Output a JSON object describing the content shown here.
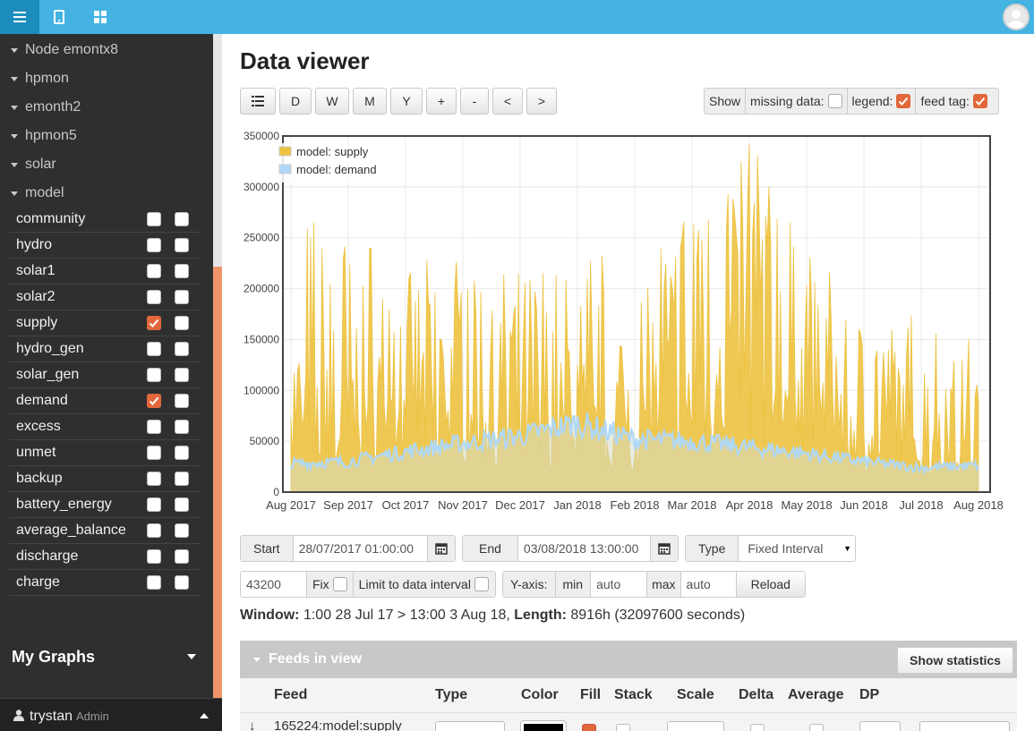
{
  "topbar": {
    "icons": [
      "menu-icon",
      "tablet-icon",
      "dashboard-icon"
    ],
    "avatar": "user-avatar-icon"
  },
  "sidebar": {
    "nodes": [
      {
        "label": "Node emontx8"
      },
      {
        "label": "hpmon"
      },
      {
        "label": "emonth2"
      },
      {
        "label": "hpmon5"
      },
      {
        "label": "solar"
      },
      {
        "label": "model"
      }
    ],
    "feeds": [
      {
        "name": "community",
        "left": false,
        "right": false
      },
      {
        "name": "hydro",
        "left": false,
        "right": false
      },
      {
        "name": "solar1",
        "left": false,
        "right": false
      },
      {
        "name": "solar2",
        "left": false,
        "right": false
      },
      {
        "name": "supply",
        "left": true,
        "right": false
      },
      {
        "name": "hydro_gen",
        "left": false,
        "right": false
      },
      {
        "name": "solar_gen",
        "left": false,
        "right": false
      },
      {
        "name": "demand",
        "left": true,
        "right": false
      },
      {
        "name": "excess",
        "left": false,
        "right": false
      },
      {
        "name": "unmet",
        "left": false,
        "right": false
      },
      {
        "name": "backup",
        "left": false,
        "right": false
      },
      {
        "name": "battery_energy",
        "left": false,
        "right": false
      },
      {
        "name": "average_balance",
        "left": false,
        "right": false
      },
      {
        "name": "discharge",
        "left": false,
        "right": false
      },
      {
        "name": "charge",
        "left": false,
        "right": false
      }
    ],
    "my_graphs": "My Graphs",
    "user": {
      "name": "trystan",
      "role": "Admin"
    }
  },
  "main": {
    "title": "Data viewer",
    "toolbar": {
      "list_icon": "list-icon",
      "buttons": [
        "D",
        "W",
        "M",
        "Y",
        "+",
        "-",
        "<",
        ">"
      ]
    },
    "show": {
      "label": "Show",
      "missing_data": {
        "label": "missing data:",
        "checked": false
      },
      "legend": {
        "label": "legend:",
        "checked": true
      },
      "feed_tag": {
        "label": "feed tag:",
        "checked": true
      }
    },
    "controls": {
      "start_label": "Start",
      "start_value": "28/07/2017 01:00:00",
      "end_label": "End",
      "end_value": "03/08/2018 13:00:00",
      "type_label": "Type",
      "type_value": "Fixed Interval",
      "interval_value": "43200",
      "fix_label": "Fix",
      "limit_label": "Limit to data interval",
      "yaxis_label": "Y-axis:",
      "min_label": "min",
      "min_value": "auto",
      "max_label": "max",
      "max_value": "auto",
      "reload_label": "Reload"
    },
    "window_info": {
      "window_label": "Window:",
      "window_value": "1:00 28 Jul 17 > 13:00 3 Aug 18,",
      "length_label": "Length:",
      "length_value": "8916h (32097600 seconds)"
    },
    "feeds_in_view": {
      "title": "Feeds in view",
      "stats_button": "Show statistics",
      "columns": [
        "Feed",
        "Type",
        "Color",
        "Fill",
        "Stack",
        "Scale",
        "Delta",
        "Average",
        "DP"
      ],
      "first_row_feed": "165224:model:supply"
    }
  },
  "chart_data": {
    "type": "area",
    "title": "",
    "xlabel": "",
    "ylabel": "",
    "ylim": [
      0,
      350000
    ],
    "yticks": [
      0,
      50000,
      100000,
      150000,
      200000,
      250000,
      300000,
      350000
    ],
    "x_tick_labels": [
      "Aug 2017",
      "Sep 2017",
      "Oct 2017",
      "Nov 2017",
      "Dec 2017",
      "Jan 2018",
      "Feb 2018",
      "Mar 2018",
      "Apr 2018",
      "May 2018",
      "Jun 2018",
      "Jul 2018",
      "Aug 2018"
    ],
    "legend_position": "top-left",
    "grid": true,
    "series": [
      {
        "name": "model: supply",
        "color": "#edc240",
        "x": [
          "Aug 2017",
          "Sep 2017",
          "Oct 2017",
          "Nov 2017",
          "Dec 2017",
          "Jan 2018",
          "Feb 2018",
          "Mar 2018",
          "Apr 2018",
          "May 2018",
          "Jun 2018",
          "Jul 2018",
          "Aug 2018"
        ],
        "values": [
          120000,
          130000,
          150000,
          160000,
          140000,
          120000,
          110000,
          230000,
          270000,
          180000,
          120000,
          100000,
          90000
        ],
        "peaks": [
          275000,
          265000,
          215000,
          250000,
          215000,
          240000,
          240000,
          285000,
          315000,
          250000,
          165000,
          180000,
          160000
        ]
      },
      {
        "name": "model: demand",
        "color": "#afd8f8",
        "x": [
          "Aug 2017",
          "Sep 2017",
          "Oct 2017",
          "Nov 2017",
          "Dec 2017",
          "Jan 2018",
          "Feb 2018",
          "Mar 2018",
          "Apr 2018",
          "May 2018",
          "Jun 2018",
          "Jul 2018",
          "Aug 2018"
        ],
        "values": [
          28000,
          30000,
          40000,
          48000,
          55000,
          68000,
          52000,
          50000,
          44000,
          38000,
          30000,
          24000,
          26000
        ]
      }
    ]
  }
}
